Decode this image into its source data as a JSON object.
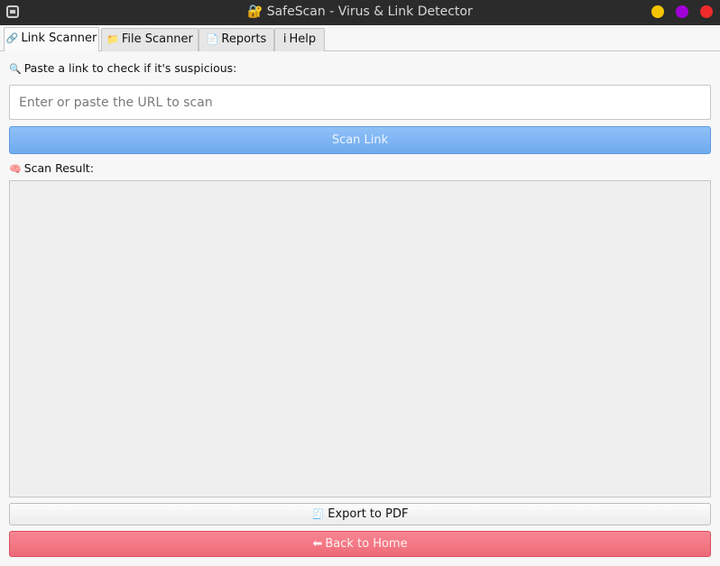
{
  "window": {
    "title": "SafeScan - Virus & Link Detector",
    "title_icon": "🔐",
    "controls": {
      "minimize_color": "#f5c400",
      "maximize_color": "#a200d8",
      "close_color": "#ef2b2b"
    }
  },
  "tabs": [
    {
      "icon": "🔗",
      "label": "Link Scanner",
      "active": true
    },
    {
      "icon": "📁",
      "label": "File Scanner",
      "active": false
    },
    {
      "icon": "📄",
      "label": "Reports",
      "active": false
    },
    {
      "icon": "i",
      "label": "Help",
      "active": false
    }
  ],
  "link_scanner": {
    "prompt_icon": "🔍",
    "prompt": "Paste a link to check if it's suspicious:",
    "url_input": {
      "value": "",
      "placeholder": "Enter or paste the URL to scan"
    },
    "scan_button": "Scan Link",
    "result_icon": "🧠",
    "result_label": "Scan Result:",
    "result_text": "",
    "export_icon": "🧾",
    "export_button": "Export to PDF",
    "home_icon": "⬅",
    "home_button": "Back to Home"
  },
  "colors": {
    "scan_button": "#7fb6f3",
    "home_button": "#f27a86",
    "titlebar": "#2b2b2b"
  }
}
